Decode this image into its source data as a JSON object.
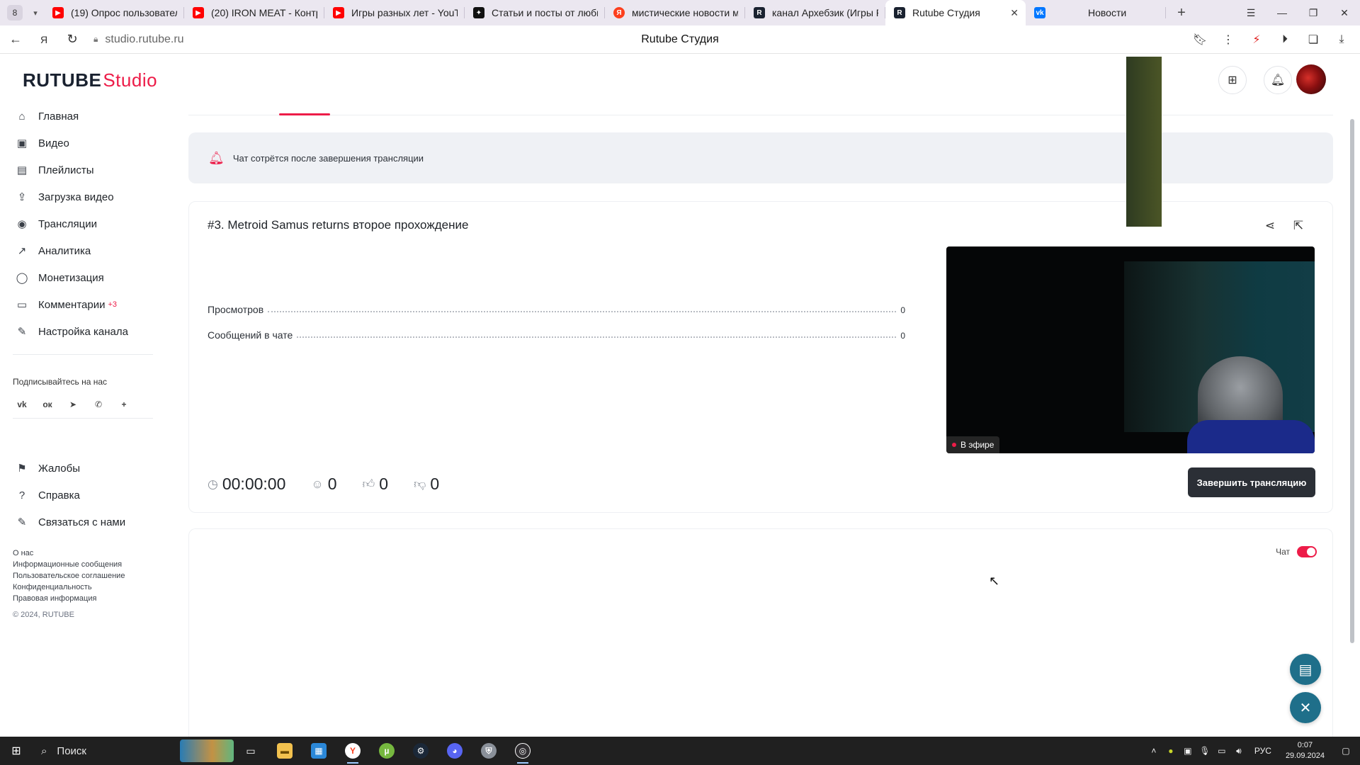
{
  "browser": {
    "tab_counter": "8",
    "tabs": [
      {
        "title": "(19) Опрос пользователя",
        "favicon": "youtube-icon",
        "color": "#ff0000"
      },
      {
        "title": "(20) IRON MEAT - Контра",
        "favicon": "youtube-icon",
        "color": "#ff0000"
      },
      {
        "title": "Игры разных лет - YouTube",
        "favicon": "youtube-icon",
        "color": "#ff0000"
      },
      {
        "title": "Статьи и посты от любим",
        "favicon": "dzen-icon",
        "color": "#111111"
      },
      {
        "title": "мистические новости ми",
        "favicon": "yandex-icon",
        "color": "#fc3f1d"
      },
      {
        "title": "канал Архебзик (Игры Р",
        "favicon": "rutube-icon",
        "color": "#1a2230"
      },
      {
        "title": "Rutube Студия",
        "favicon": "rutube-icon",
        "color": "#1a2230",
        "active": true
      },
      {
        "title": "Новости",
        "favicon": "vk-icon",
        "color": "#0077ff"
      }
    ],
    "url": "studio.rutube.ru",
    "page_title": "Rutube Студия"
  },
  "header": {
    "logo_main": "RUTUBE",
    "logo_studio": "Studio"
  },
  "sidebar": {
    "items": [
      {
        "label": "Главная",
        "icon": "home-icon"
      },
      {
        "label": "Видео",
        "icon": "video-icon"
      },
      {
        "label": "Плейлисты",
        "icon": "playlist-icon"
      },
      {
        "label": "Загрузка видео",
        "icon": "upload-icon"
      },
      {
        "label": "Трансляции",
        "icon": "broadcast-icon"
      },
      {
        "label": "Аналитика",
        "icon": "analytics-icon"
      },
      {
        "label": "Монетизация",
        "icon": "monetization-icon"
      },
      {
        "label": "Комментарии",
        "icon": "comments-icon",
        "badge": "+3"
      },
      {
        "label": "Настройка канала",
        "icon": "channel-settings-icon"
      }
    ],
    "follow_label": "Подписывайтесь на нас",
    "socials": [
      "vk-icon",
      "ok-icon",
      "telegram-icon",
      "viber-icon",
      "more-icon"
    ],
    "secondary": [
      {
        "label": "Жалобы",
        "icon": "flag-icon"
      },
      {
        "label": "Справка",
        "icon": "help-icon"
      },
      {
        "label": "Связаться с нами",
        "icon": "contact-icon"
      }
    ],
    "footer_links": [
      "О нас",
      "Информационные сообщения",
      "Пользовательское соглашение",
      "Конфиденциальность",
      "Правовая информация"
    ],
    "copyright": "© 2024, RUTUBE"
  },
  "main": {
    "notice": "Чат сотрётся после завершения трансляции",
    "stream": {
      "title": "#3. Metroid Samus returns второе прохождение",
      "stats": [
        {
          "label": "Просмотров",
          "value": "0"
        },
        {
          "label": "Сообщений в чате",
          "value": "0"
        }
      ],
      "live_badge": "В эфире",
      "duration": "00:00:00",
      "viewers": "0",
      "likes": "0",
      "dislikes": "0",
      "end_button": "Завершить трансляцию"
    },
    "chat": {
      "toggle_label": "Чат",
      "enabled": true
    }
  },
  "taskbar": {
    "search_label": "Поиск",
    "language": "РУС",
    "time": "0:07",
    "date": "29.09.2024"
  },
  "colors": {
    "brand": "#ed1c48",
    "dark_button": "#2b2f36",
    "fab": "#1f6f8a"
  }
}
